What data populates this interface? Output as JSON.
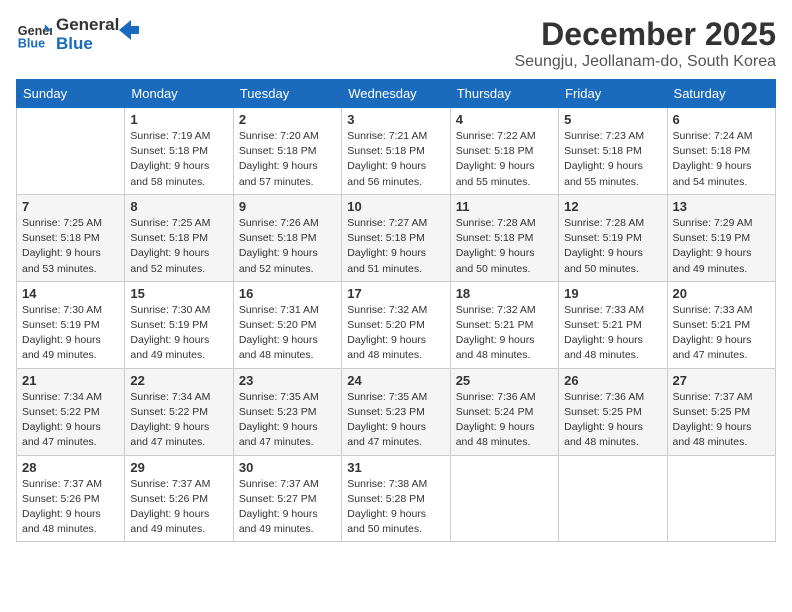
{
  "header": {
    "logo_line1": "General",
    "logo_line2": "Blue",
    "month_title": "December 2025",
    "location": "Seungju, Jeollanam-do, South Korea"
  },
  "weekdays": [
    "Sunday",
    "Monday",
    "Tuesday",
    "Wednesday",
    "Thursday",
    "Friday",
    "Saturday"
  ],
  "weeks": [
    [
      {
        "day": "",
        "info": ""
      },
      {
        "day": "1",
        "info": "Sunrise: 7:19 AM\nSunset: 5:18 PM\nDaylight: 9 hours\nand 58 minutes."
      },
      {
        "day": "2",
        "info": "Sunrise: 7:20 AM\nSunset: 5:18 PM\nDaylight: 9 hours\nand 57 minutes."
      },
      {
        "day": "3",
        "info": "Sunrise: 7:21 AM\nSunset: 5:18 PM\nDaylight: 9 hours\nand 56 minutes."
      },
      {
        "day": "4",
        "info": "Sunrise: 7:22 AM\nSunset: 5:18 PM\nDaylight: 9 hours\nand 55 minutes."
      },
      {
        "day": "5",
        "info": "Sunrise: 7:23 AM\nSunset: 5:18 PM\nDaylight: 9 hours\nand 55 minutes."
      },
      {
        "day": "6",
        "info": "Sunrise: 7:24 AM\nSunset: 5:18 PM\nDaylight: 9 hours\nand 54 minutes."
      }
    ],
    [
      {
        "day": "7",
        "info": "Sunrise: 7:25 AM\nSunset: 5:18 PM\nDaylight: 9 hours\nand 53 minutes."
      },
      {
        "day": "8",
        "info": "Sunrise: 7:25 AM\nSunset: 5:18 PM\nDaylight: 9 hours\nand 52 minutes."
      },
      {
        "day": "9",
        "info": "Sunrise: 7:26 AM\nSunset: 5:18 PM\nDaylight: 9 hours\nand 52 minutes."
      },
      {
        "day": "10",
        "info": "Sunrise: 7:27 AM\nSunset: 5:18 PM\nDaylight: 9 hours\nand 51 minutes."
      },
      {
        "day": "11",
        "info": "Sunrise: 7:28 AM\nSunset: 5:18 PM\nDaylight: 9 hours\nand 50 minutes."
      },
      {
        "day": "12",
        "info": "Sunrise: 7:28 AM\nSunset: 5:19 PM\nDaylight: 9 hours\nand 50 minutes."
      },
      {
        "day": "13",
        "info": "Sunrise: 7:29 AM\nSunset: 5:19 PM\nDaylight: 9 hours\nand 49 minutes."
      }
    ],
    [
      {
        "day": "14",
        "info": "Sunrise: 7:30 AM\nSunset: 5:19 PM\nDaylight: 9 hours\nand 49 minutes."
      },
      {
        "day": "15",
        "info": "Sunrise: 7:30 AM\nSunset: 5:19 PM\nDaylight: 9 hours\nand 49 minutes."
      },
      {
        "day": "16",
        "info": "Sunrise: 7:31 AM\nSunset: 5:20 PM\nDaylight: 9 hours\nand 48 minutes."
      },
      {
        "day": "17",
        "info": "Sunrise: 7:32 AM\nSunset: 5:20 PM\nDaylight: 9 hours\nand 48 minutes."
      },
      {
        "day": "18",
        "info": "Sunrise: 7:32 AM\nSunset: 5:21 PM\nDaylight: 9 hours\nand 48 minutes."
      },
      {
        "day": "19",
        "info": "Sunrise: 7:33 AM\nSunset: 5:21 PM\nDaylight: 9 hours\nand 48 minutes."
      },
      {
        "day": "20",
        "info": "Sunrise: 7:33 AM\nSunset: 5:21 PM\nDaylight: 9 hours\nand 47 minutes."
      }
    ],
    [
      {
        "day": "21",
        "info": "Sunrise: 7:34 AM\nSunset: 5:22 PM\nDaylight: 9 hours\nand 47 minutes."
      },
      {
        "day": "22",
        "info": "Sunrise: 7:34 AM\nSunset: 5:22 PM\nDaylight: 9 hours\nand 47 minutes."
      },
      {
        "day": "23",
        "info": "Sunrise: 7:35 AM\nSunset: 5:23 PM\nDaylight: 9 hours\nand 47 minutes."
      },
      {
        "day": "24",
        "info": "Sunrise: 7:35 AM\nSunset: 5:23 PM\nDaylight: 9 hours\nand 47 minutes."
      },
      {
        "day": "25",
        "info": "Sunrise: 7:36 AM\nSunset: 5:24 PM\nDaylight: 9 hours\nand 48 minutes."
      },
      {
        "day": "26",
        "info": "Sunrise: 7:36 AM\nSunset: 5:25 PM\nDaylight: 9 hours\nand 48 minutes."
      },
      {
        "day": "27",
        "info": "Sunrise: 7:37 AM\nSunset: 5:25 PM\nDaylight: 9 hours\nand 48 minutes."
      }
    ],
    [
      {
        "day": "28",
        "info": "Sunrise: 7:37 AM\nSunset: 5:26 PM\nDaylight: 9 hours\nand 48 minutes."
      },
      {
        "day": "29",
        "info": "Sunrise: 7:37 AM\nSunset: 5:26 PM\nDaylight: 9 hours\nand 49 minutes."
      },
      {
        "day": "30",
        "info": "Sunrise: 7:37 AM\nSunset: 5:27 PM\nDaylight: 9 hours\nand 49 minutes."
      },
      {
        "day": "31",
        "info": "Sunrise: 7:38 AM\nSunset: 5:28 PM\nDaylight: 9 hours\nand 50 minutes."
      },
      {
        "day": "",
        "info": ""
      },
      {
        "day": "",
        "info": ""
      },
      {
        "day": "",
        "info": ""
      }
    ]
  ]
}
